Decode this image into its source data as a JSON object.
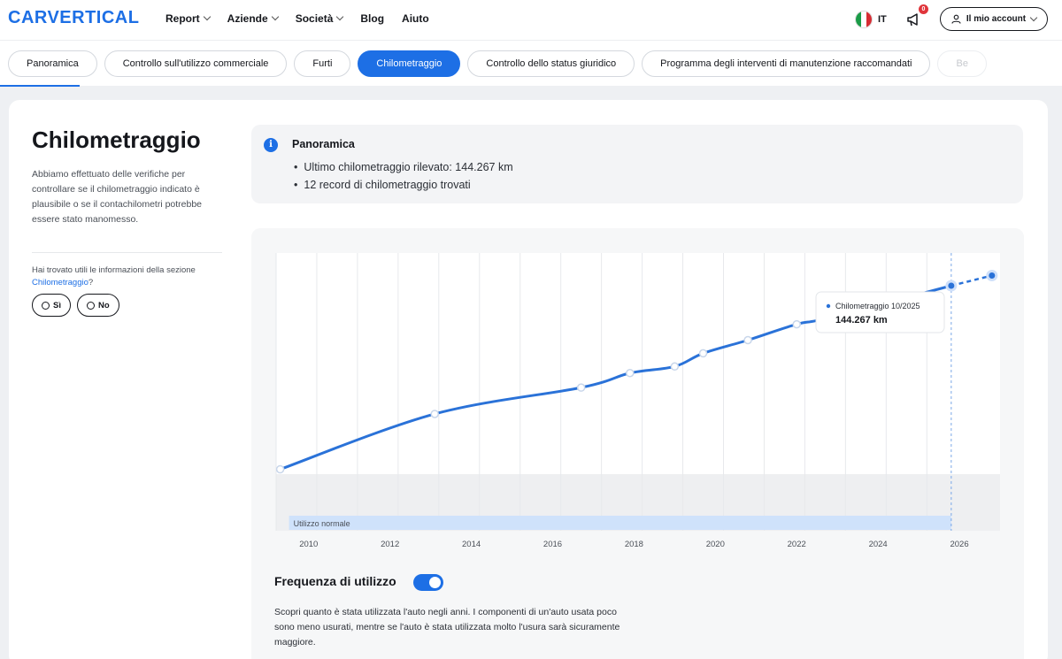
{
  "header": {
    "logo": "CARVERTICAL",
    "nav": [
      "Report",
      "Aziende",
      "Società",
      "Blog",
      "Aiuto"
    ],
    "language": "IT",
    "notification_count": "0",
    "account_label": "Il mio account"
  },
  "tabs": [
    {
      "label": "Panoramica",
      "active": false
    },
    {
      "label": "Controllo sull'utilizzo commerciale",
      "active": false
    },
    {
      "label": "Furti",
      "active": false
    },
    {
      "label": "Chilometraggio",
      "active": true
    },
    {
      "label": "Controllo dello status giuridico",
      "active": false
    },
    {
      "label": "Programma degli interventi di manutenzione raccomandati",
      "active": false
    },
    {
      "label": "Be",
      "active": false
    }
  ],
  "section": {
    "title": "Chilometraggio",
    "description": "Abbiamo effettuato delle verifiche per controllare se il chilometraggio indicato è plausibile o se il contachilometri potrebbe essere stato manomesso.",
    "feedback_question": "Hai trovato utili le informazioni della sezione ",
    "feedback_link": "Chilometraggio",
    "feedback_suffix": "?",
    "yes_label": "Sì",
    "no_label": "No"
  },
  "overview": {
    "title": "Panoramica",
    "items": [
      "Ultimo chilometraggio rilevato: 144.267 km",
      "12 record di chilometraggio trovati"
    ]
  },
  "chart_data": {
    "type": "line",
    "x_ticks": [
      "2010",
      "2012",
      "2014",
      "2016",
      "2018",
      "2020",
      "2022",
      "2024",
      "2026"
    ],
    "xlim": [
      2009.2,
      2027.0
    ],
    "ylim": [
      0,
      144267
    ],
    "points": [
      {
        "x": 2009.3,
        "y": 5000
      },
      {
        "x": 2013.1,
        "y": 47000
      },
      {
        "x": 2016.7,
        "y": 67000
      },
      {
        "x": 2017.9,
        "y": 78000
      },
      {
        "x": 2019.0,
        "y": 83000
      },
      {
        "x": 2019.7,
        "y": 93000
      },
      {
        "x": 2020.8,
        "y": 103000
      },
      {
        "x": 2022.0,
        "y": 115000
      },
      {
        "x": 2022.8,
        "y": 120000
      },
      {
        "x": 2025.8,
        "y": 144267
      }
    ],
    "projection": {
      "x": 2026.8,
      "y": 152000
    },
    "band_label": "Utilizzo normale",
    "tooltip": {
      "label": "Chilometraggio 10/2025",
      "value": "144.267 km"
    },
    "line_color": "#2a72d8"
  },
  "frequency": {
    "title": "Frequenza di utilizzo",
    "toggle_on": true,
    "description": "Scopri quanto è stata utilizzata l'auto negli anni. I componenti di un'auto usata poco sono meno usurati, mentre se l'auto è stata utilizzata molto l'usura sarà sicuramente maggiore."
  }
}
